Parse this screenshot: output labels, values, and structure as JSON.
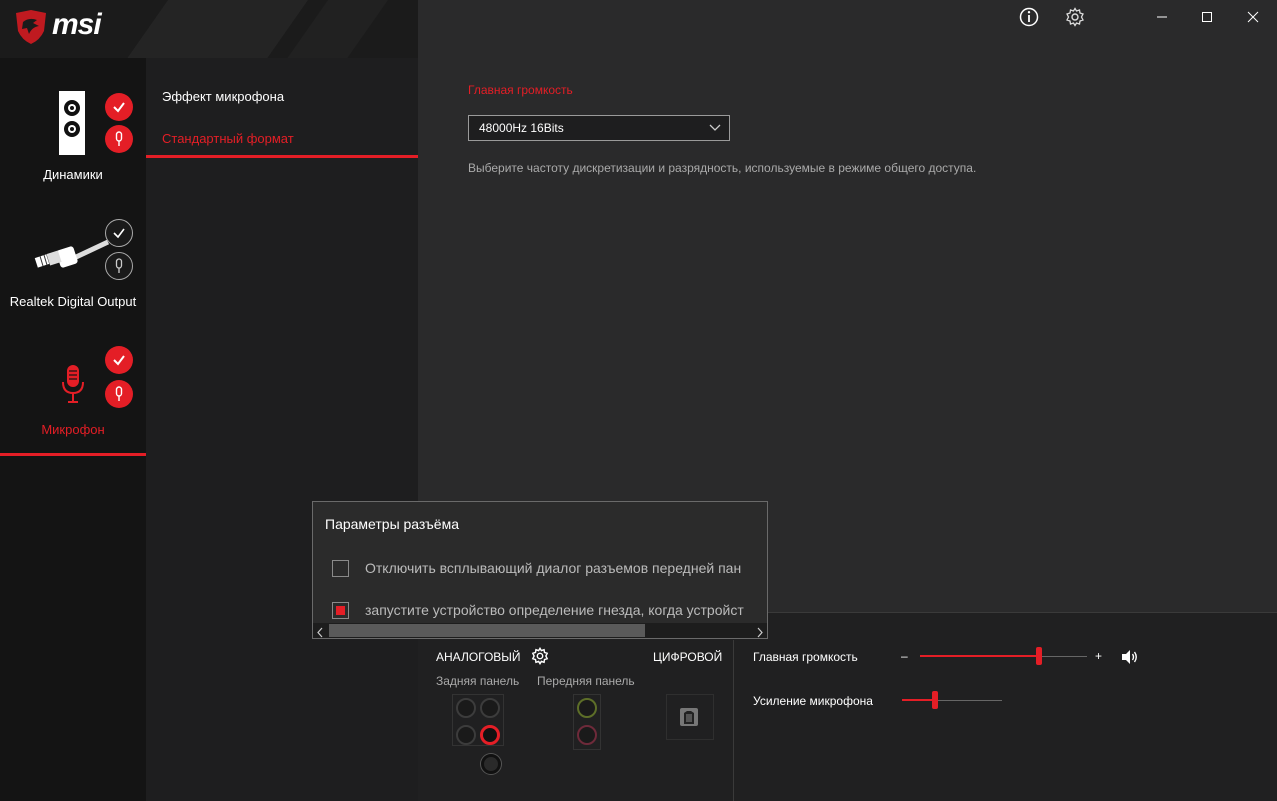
{
  "brand": {
    "logo_text": "msi"
  },
  "window": {
    "info_icon": "info-icon",
    "settings_icon": "gear-icon",
    "minimize_icon": "minimize-icon",
    "maximize_icon": "maximize-icon",
    "close_icon": "close-icon"
  },
  "devices": [
    {
      "label": "Динамики",
      "icon": "speaker-icon",
      "active": false
    },
    {
      "label": "Realtek Digital Output",
      "icon": "optical-cable-icon",
      "active": false
    },
    {
      "label": "Микрофон",
      "icon": "microphone-icon",
      "active": true
    }
  ],
  "submenu": {
    "items": [
      {
        "label": "Эффект микрофона",
        "active": false
      },
      {
        "label": "Стандартный формат",
        "active": true
      }
    ]
  },
  "main": {
    "section_title": "Главная громкость",
    "format_select_value": "48000Hz 16Bits",
    "description": "Выберите частоту дискретизации и разрядность, используемые в режиме общего доступа."
  },
  "popup": {
    "title": "Параметры разъёма",
    "option1": {
      "label": "Отключить всплывающий диалог разъемов передней пан",
      "checked": false
    },
    "option2": {
      "label": "запустите устройство определение гнезда, когда  устройст",
      "checked": true
    }
  },
  "connectors": {
    "analog_label": "АНАЛОГОВЫЙ",
    "digital_label": "ЦИФРОВОЙ",
    "rear_panel_label": "Задняя панель",
    "front_panel_label": "Передняя панель"
  },
  "levels": {
    "master_volume_label": "Главная громкость",
    "master_volume_value": 0.71,
    "minus_symbol": "–",
    "plus_symbol": "+",
    "mic_boost_label": "Усиление микрофона",
    "mic_boost_value": 0.33
  },
  "colors": {
    "accent": "#e41e26",
    "background": "#2a2a2b",
    "sidebar": "#141414"
  }
}
